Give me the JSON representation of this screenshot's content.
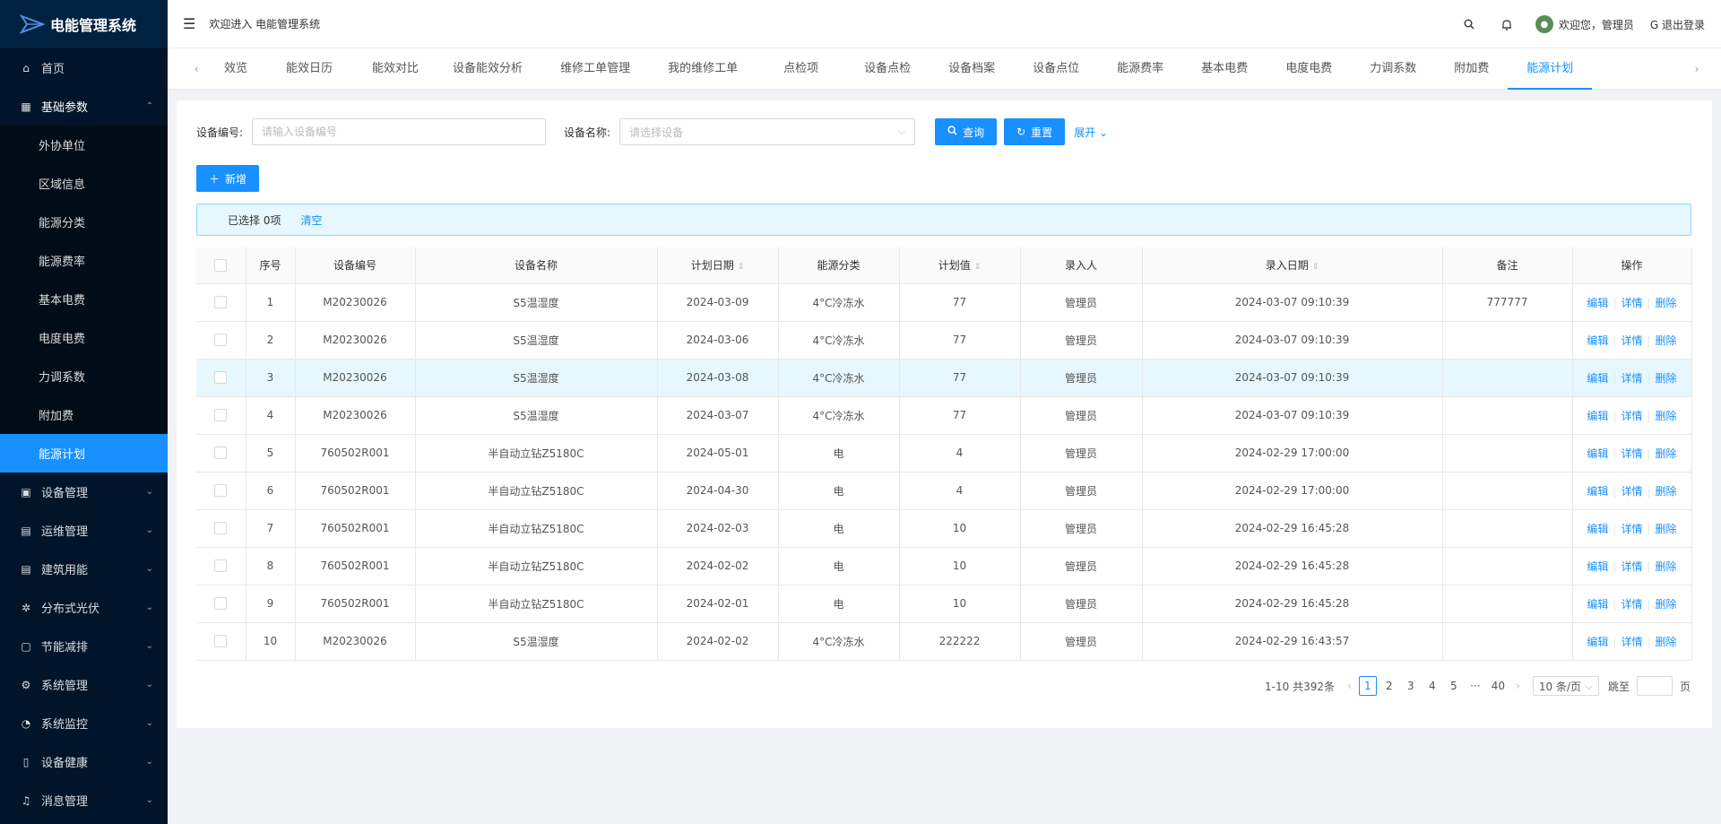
{
  "app": {
    "title": "电能管理系统"
  },
  "header": {
    "welcome": "欢迎进入 电能管理系统",
    "user_greeting": "欢迎您，管理员",
    "logout": "退出登录"
  },
  "sidebar": {
    "items": [
      {
        "label": "首页",
        "icon": "home-icon"
      },
      {
        "label": "基础参数",
        "icon": "table-icon",
        "expanded": true
      },
      {
        "label": "设备管理",
        "icon": "device-icon"
      },
      {
        "label": "运维管理",
        "icon": "doc-icon"
      },
      {
        "label": "建筑用能",
        "icon": "doc-icon"
      },
      {
        "label": "分布式光伏",
        "icon": "solar-icon"
      },
      {
        "label": "节能减排",
        "icon": "doc-icon"
      },
      {
        "label": "系统管理",
        "icon": "gear-icon"
      },
      {
        "label": "系统监控",
        "icon": "monitor-icon"
      },
      {
        "label": "设备健康",
        "icon": "health-icon"
      },
      {
        "label": "消息管理",
        "icon": "message-icon"
      }
    ],
    "sub_items": [
      "外协单位",
      "区域信息",
      "能源分类",
      "能源费率",
      "基本电费",
      "电度电费",
      "力调系数",
      "附加费",
      "能源计划"
    ],
    "active_sub": "能源计划"
  },
  "tabs": [
    "效览",
    "能效日历",
    "能效对比",
    "设备能效分析",
    "维修工单管理",
    "我的维修工单",
    "点检项",
    "设备点检",
    "设备档案",
    "设备点位",
    "能源费率",
    "基本电费",
    "电度电费",
    "力调系数",
    "附加费",
    "能源计划"
  ],
  "active_tab": "能源计划",
  "search": {
    "code_label": "设备编号:",
    "code_placeholder": "请输入设备编号",
    "name_label": "设备名称:",
    "name_placeholder": "请选择设备",
    "query": "查询",
    "reset": "重置",
    "expand": "展开"
  },
  "add_label": "新增",
  "selection": {
    "text": "已选择 0项",
    "clear": "清空"
  },
  "table": {
    "columns": [
      "序号",
      "设备编号",
      "设备名称",
      "计划日期",
      "能源分类",
      "计划值",
      "录入人",
      "录入日期",
      "备注",
      "操作"
    ],
    "actions": [
      "编辑",
      "详情",
      "删除"
    ],
    "rows": [
      [
        "1",
        "M20230026",
        "S5温湿度",
        "2024-03-09",
        "4°C冷冻水",
        "77",
        "管理员",
        "2024-03-07 09:10:39",
        "777777"
      ],
      [
        "2",
        "M20230026",
        "S5温湿度",
        "2024-03-06",
        "4°C冷冻水",
        "77",
        "管理员",
        "2024-03-07 09:10:39",
        ""
      ],
      [
        "3",
        "M20230026",
        "S5温湿度",
        "2024-03-08",
        "4°C冷冻水",
        "77",
        "管理员",
        "2024-03-07 09:10:39",
        ""
      ],
      [
        "4",
        "M20230026",
        "S5温湿度",
        "2024-03-07",
        "4°C冷冻水",
        "77",
        "管理员",
        "2024-03-07 09:10:39",
        ""
      ],
      [
        "5",
        "760502R001",
        "半自动立钻Z5180C",
        "2024-05-01",
        "电",
        "4",
        "管理员",
        "2024-02-29 17:00:00",
        ""
      ],
      [
        "6",
        "760502R001",
        "半自动立钻Z5180C",
        "2024-04-30",
        "电",
        "4",
        "管理员",
        "2024-02-29 17:00:00",
        ""
      ],
      [
        "7",
        "760502R001",
        "半自动立钻Z5180C",
        "2024-02-03",
        "电",
        "10",
        "管理员",
        "2024-02-29 16:45:28",
        ""
      ],
      [
        "8",
        "760502R001",
        "半自动立钻Z5180C",
        "2024-02-02",
        "电",
        "10",
        "管理员",
        "2024-02-29 16:45:28",
        ""
      ],
      [
        "9",
        "760502R001",
        "半自动立钻Z5180C",
        "2024-02-01",
        "电",
        "10",
        "管理员",
        "2024-02-29 16:45:28",
        ""
      ],
      [
        "10",
        "M20230026",
        "S5温湿度",
        "2024-02-02",
        "4°C冷冻水",
        "222222",
        "管理员",
        "2024-02-29 16:43:57",
        ""
      ]
    ],
    "highlight_row": 3
  },
  "pagination": {
    "total": "1-10 共392条",
    "pages": [
      "1",
      "2",
      "3",
      "4",
      "5",
      "···",
      "40"
    ],
    "active_page": "1",
    "page_size": "10 条/页",
    "jump_label": "跳至",
    "page_unit": "页"
  },
  "colors": {
    "primary": "#1890ff",
    "sidebar_bg": "#001529"
  }
}
